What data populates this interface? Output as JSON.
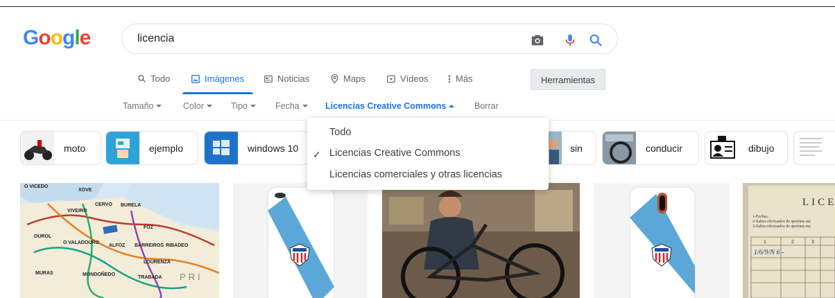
{
  "logo": {
    "letters": [
      "G",
      "o",
      "o",
      "g",
      "l",
      "e"
    ]
  },
  "search": {
    "query": "licencia"
  },
  "tabs": [
    {
      "label": "Todo",
      "icon": "search-icon"
    },
    {
      "label": "Imágenes",
      "icon": "image-icon"
    },
    {
      "label": "Noticias",
      "icon": "news-icon"
    },
    {
      "label": "Maps",
      "icon": "map-pin-icon"
    },
    {
      "label": "Vídeos",
      "icon": "video-icon"
    },
    {
      "label": "Más",
      "icon": "more-vertical-icon"
    }
  ],
  "tools_label": "Herramientas",
  "filters": [
    {
      "label": "Tamaño"
    },
    {
      "label": "Color"
    },
    {
      "label": "Tipo"
    },
    {
      "label": "Fecha"
    },
    {
      "label": "Licencias Creative Commons"
    },
    {
      "label": "Borrar"
    }
  ],
  "chips": [
    {
      "label": "moto"
    },
    {
      "label": "ejemplo"
    },
    {
      "label": "windows 10"
    },
    {
      "label": "sin"
    },
    {
      "label": "conducir"
    },
    {
      "label": "dibujo"
    }
  ],
  "dropdown": {
    "items": [
      "Todo",
      "Licencias Creative Commons",
      "Licencias comerciales y otras licencias"
    ],
    "selected": "Licencias Creative Commons"
  },
  "results": {
    "map_labels": [
      "O VICEDO",
      "XOVE",
      "VIVEIRO",
      "CERVO",
      "BURELA",
      "FOZ",
      "OUROL",
      "O VALADOURO",
      "ALFOZ",
      "BARREIROS",
      "RIBADEO",
      "LOURENZÁ",
      "MONDOÑEDO",
      "TRABADA",
      "MURAS",
      "PRI"
    ],
    "document_text": {
      "header": "LICE",
      "lines": [
        "1-Fechas.",
        "2-Saltos efectuados de apertura aut",
        "3-Saltos efectuados de apertura ma"
      ],
      "cols": [
        "1",
        "2",
        "3"
      ],
      "row": "1/6/9/N  6  -"
    }
  },
  "colors": {
    "accent": "#1a73e8",
    "text": "#202124",
    "muted": "#70757a"
  }
}
